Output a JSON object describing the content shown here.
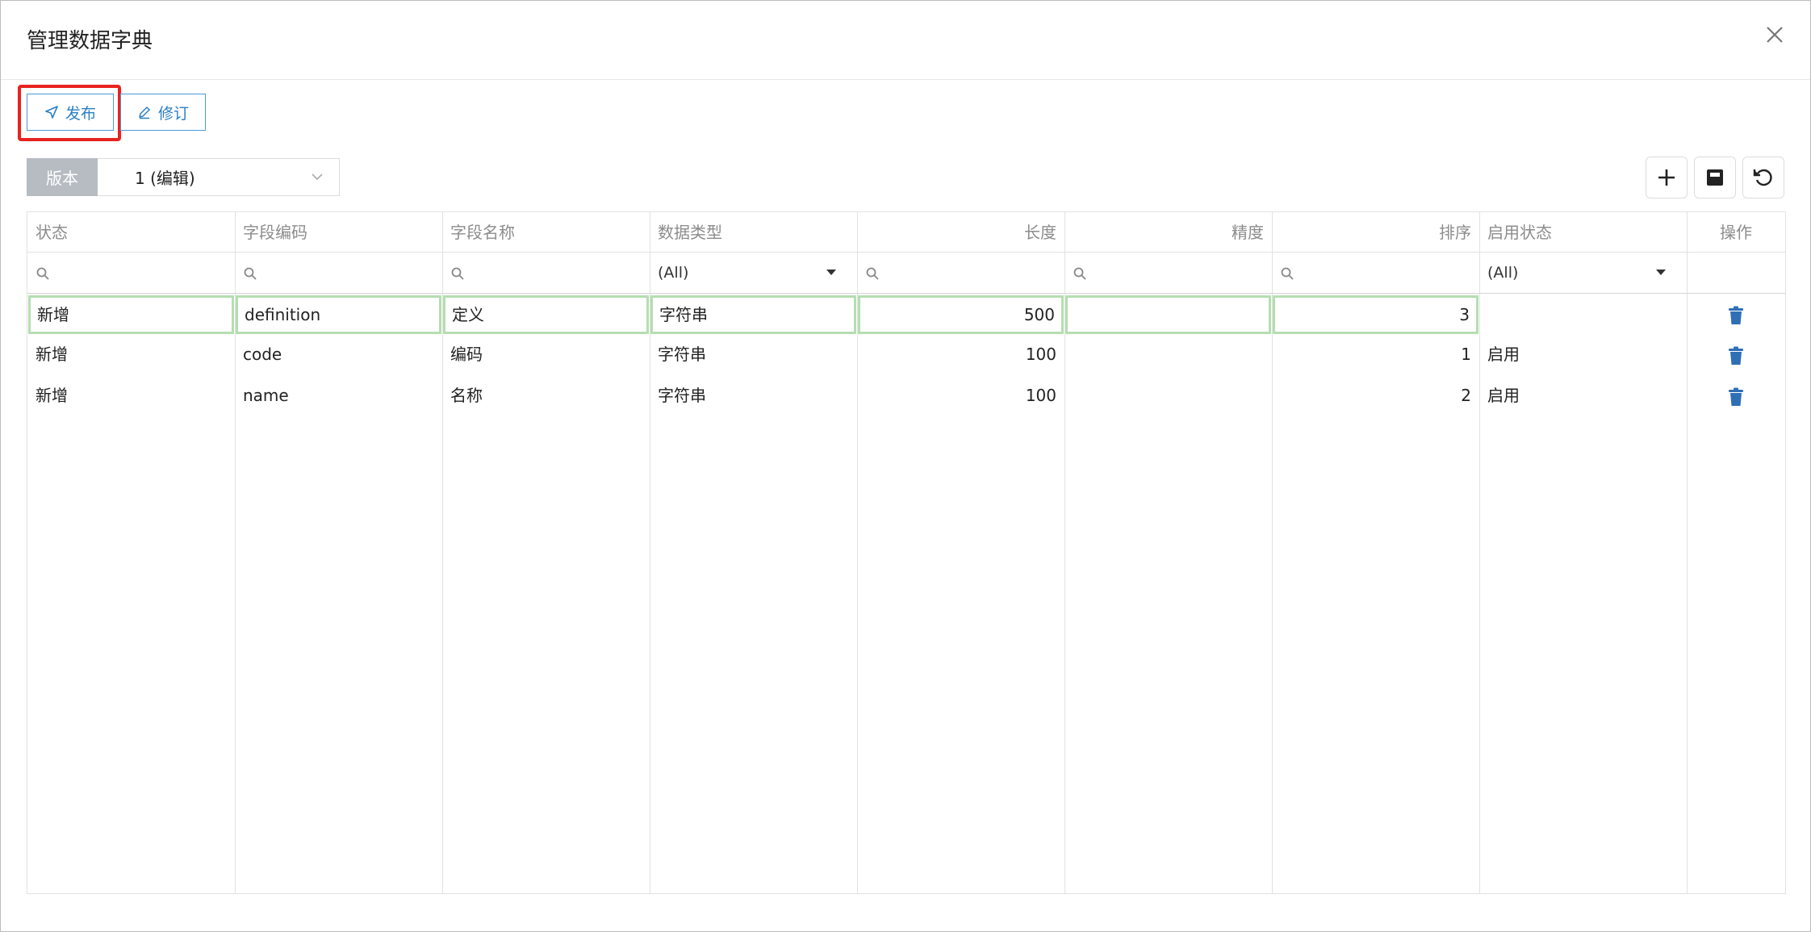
{
  "dialog": {
    "title": "管理数据字典"
  },
  "toolbar": {
    "publish_label": "发布",
    "revise_label": "修订"
  },
  "version": {
    "label": "版本",
    "value": "1 (编辑)"
  },
  "grid": {
    "columns": [
      "状态",
      "字段编码",
      "字段名称",
      "数据类型",
      "长度",
      "精度",
      "排序",
      "启用状态",
      "操作"
    ],
    "filters": {
      "data_type": "(All)",
      "enable_status": "(All)"
    },
    "rows": [
      {
        "status": "新增",
        "code": "definition",
        "name": "定义",
        "type": "字符串",
        "length": "500",
        "precision": "",
        "order": "3",
        "enabled": ""
      },
      {
        "status": "新增",
        "code": "code",
        "name": "编码",
        "type": "字符串",
        "length": "100",
        "precision": "",
        "order": "1",
        "enabled": "启用"
      },
      {
        "status": "新增",
        "code": "name",
        "name": "名称",
        "type": "字符串",
        "length": "100",
        "precision": "",
        "order": "2",
        "enabled": "启用"
      }
    ]
  },
  "colors": {
    "accent": "#2b7fc4",
    "highlight": "#e8231f",
    "edited_cell": "#b5deb1",
    "trash_icon": "#2f6fb5"
  },
  "icons": [
    "close-icon",
    "send-icon",
    "edit-pen-icon",
    "chevron-down-icon",
    "plus-icon",
    "save-icon",
    "undo-icon",
    "search-icon",
    "trash-icon"
  ]
}
